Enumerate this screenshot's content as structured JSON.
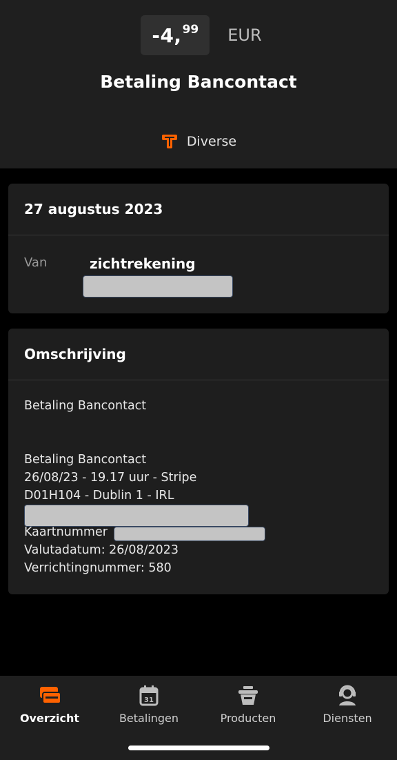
{
  "transaction": {
    "amount_int": "-4,",
    "amount_dec": "99",
    "currency": "EUR",
    "title": "Betaling Bancontact",
    "category": "Diverse",
    "category_icon": "tag-icon",
    "accent_color": "#ff6200"
  },
  "details_card": {
    "date": "27 augustus 2023",
    "from_label": "Van",
    "account_name": "zichtrekening"
  },
  "description_card": {
    "heading": "Omschrijving",
    "line1": "Betaling Bancontact",
    "line2": "Betaling Bancontact",
    "line3": "26/08/23 - 19.17 uur - Stripe",
    "line4": "D01H104 - Dublin 1 - IRL",
    "card_number_label": "Kaartnummer",
    "value_date": "Valutadatum: 26/08/2023",
    "transaction_number": "Verrichtingnummer: 580"
  },
  "nav": {
    "items": [
      {
        "label": "Overzicht",
        "icon": "overview-icon",
        "active": true
      },
      {
        "label": "Betalingen",
        "icon": "calendar-icon",
        "active": false
      },
      {
        "label": "Producten",
        "icon": "basket-icon",
        "active": false
      },
      {
        "label": "Diensten",
        "icon": "support-icon",
        "active": false
      }
    ]
  }
}
